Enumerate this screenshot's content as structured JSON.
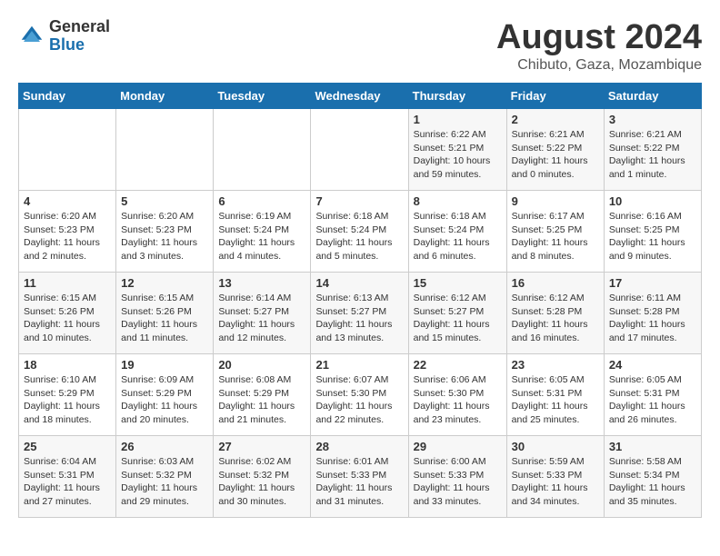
{
  "logo": {
    "line1": "General",
    "line2": "Blue"
  },
  "title": "August 2024",
  "subtitle": "Chibuto, Gaza, Mozambique",
  "days_of_week": [
    "Sunday",
    "Monday",
    "Tuesday",
    "Wednesday",
    "Thursday",
    "Friday",
    "Saturday"
  ],
  "weeks": [
    [
      {
        "day": "",
        "detail": ""
      },
      {
        "day": "",
        "detail": ""
      },
      {
        "day": "",
        "detail": ""
      },
      {
        "day": "",
        "detail": ""
      },
      {
        "day": "1",
        "detail": "Sunrise: 6:22 AM\nSunset: 5:21 PM\nDaylight: 10 hours\nand 59 minutes."
      },
      {
        "day": "2",
        "detail": "Sunrise: 6:21 AM\nSunset: 5:22 PM\nDaylight: 11 hours\nand 0 minutes."
      },
      {
        "day": "3",
        "detail": "Sunrise: 6:21 AM\nSunset: 5:22 PM\nDaylight: 11 hours\nand 1 minute."
      }
    ],
    [
      {
        "day": "4",
        "detail": "Sunrise: 6:20 AM\nSunset: 5:23 PM\nDaylight: 11 hours\nand 2 minutes."
      },
      {
        "day": "5",
        "detail": "Sunrise: 6:20 AM\nSunset: 5:23 PM\nDaylight: 11 hours\nand 3 minutes."
      },
      {
        "day": "6",
        "detail": "Sunrise: 6:19 AM\nSunset: 5:24 PM\nDaylight: 11 hours\nand 4 minutes."
      },
      {
        "day": "7",
        "detail": "Sunrise: 6:18 AM\nSunset: 5:24 PM\nDaylight: 11 hours\nand 5 minutes."
      },
      {
        "day": "8",
        "detail": "Sunrise: 6:18 AM\nSunset: 5:24 PM\nDaylight: 11 hours\nand 6 minutes."
      },
      {
        "day": "9",
        "detail": "Sunrise: 6:17 AM\nSunset: 5:25 PM\nDaylight: 11 hours\nand 8 minutes."
      },
      {
        "day": "10",
        "detail": "Sunrise: 6:16 AM\nSunset: 5:25 PM\nDaylight: 11 hours\nand 9 minutes."
      }
    ],
    [
      {
        "day": "11",
        "detail": "Sunrise: 6:15 AM\nSunset: 5:26 PM\nDaylight: 11 hours\nand 10 minutes."
      },
      {
        "day": "12",
        "detail": "Sunrise: 6:15 AM\nSunset: 5:26 PM\nDaylight: 11 hours\nand 11 minutes."
      },
      {
        "day": "13",
        "detail": "Sunrise: 6:14 AM\nSunset: 5:27 PM\nDaylight: 11 hours\nand 12 minutes."
      },
      {
        "day": "14",
        "detail": "Sunrise: 6:13 AM\nSunset: 5:27 PM\nDaylight: 11 hours\nand 13 minutes."
      },
      {
        "day": "15",
        "detail": "Sunrise: 6:12 AM\nSunset: 5:27 PM\nDaylight: 11 hours\nand 15 minutes."
      },
      {
        "day": "16",
        "detail": "Sunrise: 6:12 AM\nSunset: 5:28 PM\nDaylight: 11 hours\nand 16 minutes."
      },
      {
        "day": "17",
        "detail": "Sunrise: 6:11 AM\nSunset: 5:28 PM\nDaylight: 11 hours\nand 17 minutes."
      }
    ],
    [
      {
        "day": "18",
        "detail": "Sunrise: 6:10 AM\nSunset: 5:29 PM\nDaylight: 11 hours\nand 18 minutes."
      },
      {
        "day": "19",
        "detail": "Sunrise: 6:09 AM\nSunset: 5:29 PM\nDaylight: 11 hours\nand 20 minutes."
      },
      {
        "day": "20",
        "detail": "Sunrise: 6:08 AM\nSunset: 5:29 PM\nDaylight: 11 hours\nand 21 minutes."
      },
      {
        "day": "21",
        "detail": "Sunrise: 6:07 AM\nSunset: 5:30 PM\nDaylight: 11 hours\nand 22 minutes."
      },
      {
        "day": "22",
        "detail": "Sunrise: 6:06 AM\nSunset: 5:30 PM\nDaylight: 11 hours\nand 23 minutes."
      },
      {
        "day": "23",
        "detail": "Sunrise: 6:05 AM\nSunset: 5:31 PM\nDaylight: 11 hours\nand 25 minutes."
      },
      {
        "day": "24",
        "detail": "Sunrise: 6:05 AM\nSunset: 5:31 PM\nDaylight: 11 hours\nand 26 minutes."
      }
    ],
    [
      {
        "day": "25",
        "detail": "Sunrise: 6:04 AM\nSunset: 5:31 PM\nDaylight: 11 hours\nand 27 minutes."
      },
      {
        "day": "26",
        "detail": "Sunrise: 6:03 AM\nSunset: 5:32 PM\nDaylight: 11 hours\nand 29 minutes."
      },
      {
        "day": "27",
        "detail": "Sunrise: 6:02 AM\nSunset: 5:32 PM\nDaylight: 11 hours\nand 30 minutes."
      },
      {
        "day": "28",
        "detail": "Sunrise: 6:01 AM\nSunset: 5:33 PM\nDaylight: 11 hours\nand 31 minutes."
      },
      {
        "day": "29",
        "detail": "Sunrise: 6:00 AM\nSunset: 5:33 PM\nDaylight: 11 hours\nand 33 minutes."
      },
      {
        "day": "30",
        "detail": "Sunrise: 5:59 AM\nSunset: 5:33 PM\nDaylight: 11 hours\nand 34 minutes."
      },
      {
        "day": "31",
        "detail": "Sunrise: 5:58 AM\nSunset: 5:34 PM\nDaylight: 11 hours\nand 35 minutes."
      }
    ]
  ]
}
